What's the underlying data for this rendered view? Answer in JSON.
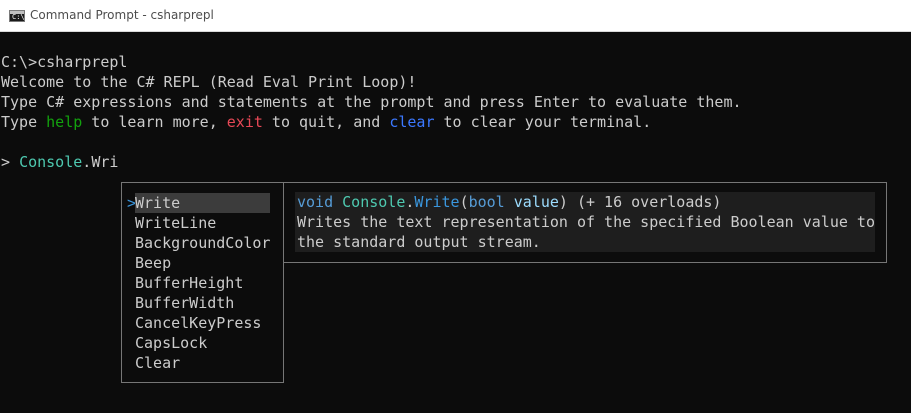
{
  "window": {
    "title": "Command Prompt - csharprepl",
    "icon": "console-app-icon",
    "icon_glyph": "C:\\"
  },
  "console": {
    "line1": "C:\\>csharprepl",
    "line2": "Welcome to the C# REPL (Read Eval Print Loop)!",
    "line3": "Type C# expressions and statements at the prompt and press Enter to evaluate them.",
    "line4": {
      "p1": "Type ",
      "help": "help",
      "p2": " to learn more, ",
      "exit": "exit",
      "p3": " to quit, and ",
      "clear": "clear",
      "p4": " to clear your terminal."
    },
    "prompt": {
      "symbol": "> ",
      "type": "Console",
      "dot": ".",
      "text": "Wri"
    }
  },
  "completion": {
    "selected_marker": ">",
    "items": [
      "Write",
      "WriteLine",
      "BackgroundColor",
      "Beep",
      "BufferHeight",
      "BufferWidth",
      "CancelKeyPress",
      "CapsLock",
      "Clear"
    ]
  },
  "documentation": {
    "signature": {
      "kw_void": "void",
      "type": "Console",
      "dot": ".",
      "method": "Write",
      "open": "(",
      "kw_bool": "bool",
      "space": " ",
      "param": "value",
      "close": ")",
      "overloads": " (+ 16 overloads)"
    },
    "summary_line1": "Writes the text representation of the specified Boolean value to",
    "summary_line2": "the standard output stream."
  },
  "colors": {
    "background": "#0c0c0c",
    "foreground": "#cccccc",
    "help": "#13a10e",
    "exit": "#e74856",
    "clear": "#3b78ff",
    "type": "#4ec9b0",
    "keyword": "#569cd6"
  }
}
